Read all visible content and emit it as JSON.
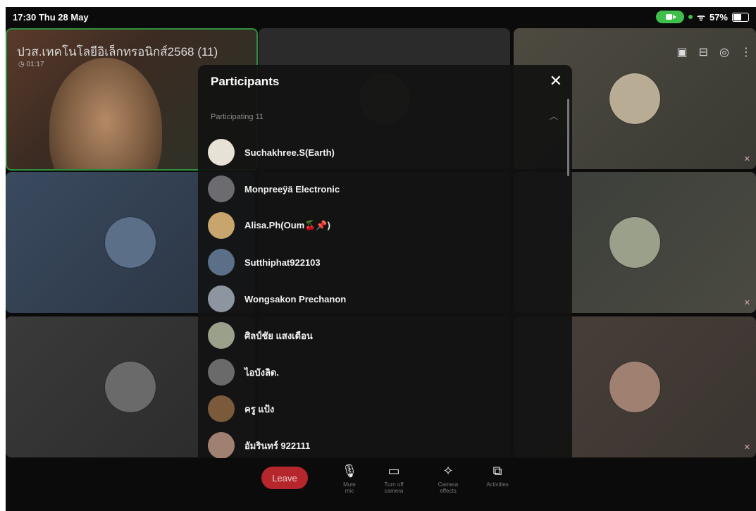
{
  "status_bar": {
    "time": "17:30  Thu 28 May",
    "battery": "57%"
  },
  "meeting": {
    "title": "ปวส.เทคโนโลยีอิเล็กทรอนิกส์2568 (11)",
    "timer": "◷ 01:17"
  },
  "panel": {
    "title": "Participants",
    "section_label": "Participating 11",
    "participants": [
      {
        "name": "Suchakhree.S(Earth)",
        "color": "#e8e2d6"
      },
      {
        "name": "Monpreeÿä Electronic",
        "color": "#6b6b70"
      },
      {
        "name": "Alisa.Ph(Oum🍒📌)",
        "color": "#c9a56e"
      },
      {
        "name": "Sutthiphat922103",
        "color": "#5b6f88"
      },
      {
        "name": "Wongsakon Prechanon",
        "color": "#8d96a0"
      },
      {
        "name": "ศิลป์ชัย แสงเดือน",
        "color": "#9aa08a"
      },
      {
        "name": "ไอบังลิด.",
        "color": "#6a6a6a"
      },
      {
        "name": "ครู แป้ง",
        "color": "#7a5a3a"
      },
      {
        "name": "อัมรินทร์ 922111",
        "color": "#a08070"
      }
    ]
  },
  "controls": {
    "leave": "Leave",
    "mute": "Mute\nmic",
    "camera": "Turn off\ncamera",
    "effects": "Camera\neffects",
    "activities": "Activities"
  },
  "colors": {
    "accent_green": "#3fbf4b",
    "leave_red": "#b5272c"
  }
}
